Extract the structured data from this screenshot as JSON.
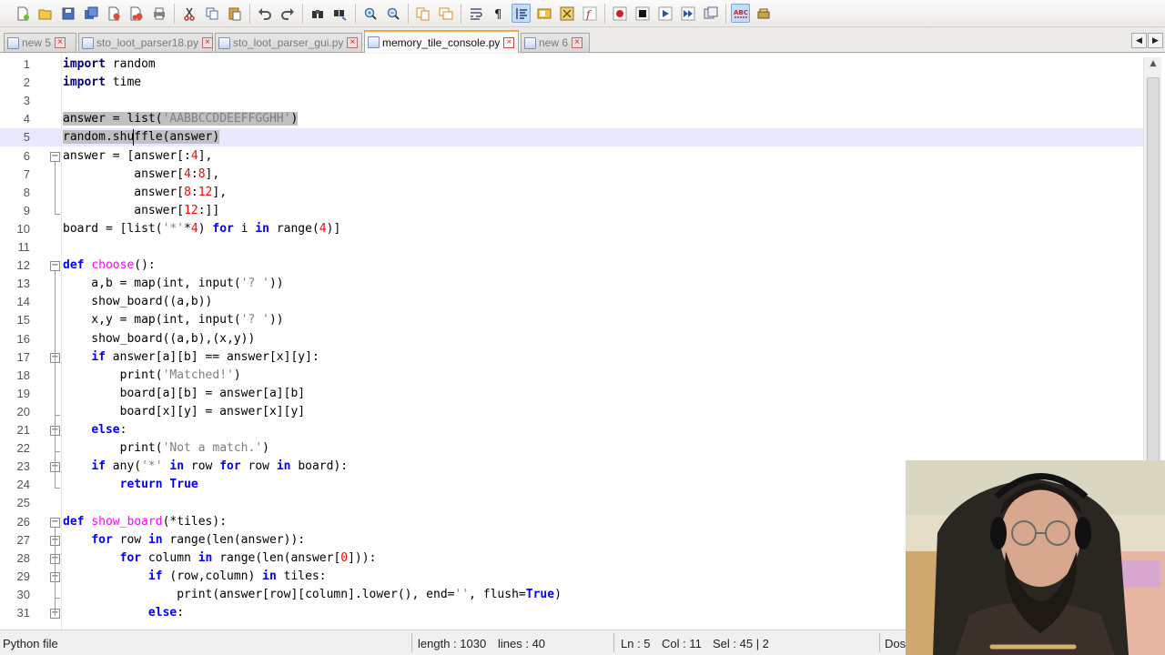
{
  "toolbar": {
    "icons": [
      "new-file",
      "open-file",
      "save",
      "save-all",
      "close",
      "close-all",
      "print",
      "cut",
      "copy",
      "paste",
      "undo",
      "redo",
      "find",
      "replace",
      "zoom-in",
      "zoom-out",
      "sync-vertical",
      "sync-horizontal",
      "word-wrap",
      "show-all-chars",
      "indent-guide",
      "user-define",
      "doc-map",
      "function-list",
      "record-macro",
      "stop-record",
      "play-macro",
      "run-macro-multiple",
      "save-macro",
      "spell-check",
      "trash"
    ]
  },
  "tabs": [
    {
      "label": "new  5",
      "active": false
    },
    {
      "label": "sto_loot_parser18.py",
      "active": false
    },
    {
      "label": "sto_loot_parser_gui.py",
      "active": false
    },
    {
      "label": "memory_tile_console.py",
      "active": true
    },
    {
      "label": "new  6",
      "active": false
    }
  ],
  "editor": {
    "language": "Python",
    "current_line": 5,
    "lines": [
      "import random",
      "import time",
      "",
      "answer = list('AABBCCDDEEFFGGHH')",
      "random.shuffle(answer)",
      "answer = [answer[:4],",
      "          answer[4:8],",
      "          answer[8:12],",
      "          answer[12:]]",
      "board = [list('*'*4) for i in range(4)]",
      "",
      "def choose():",
      "    a,b = map(int, input('? '))",
      "    show_board((a,b))",
      "    x,y = map(int, input('? '))",
      "    show_board((a,b),(x,y))",
      "    if answer[a][b] == answer[x][y]:",
      "        print('Matched!')",
      "        board[a][b] = answer[a][b]",
      "        board[x][y] = answer[x][y]",
      "    else:",
      "        print('Not a match.')",
      "    if any('*' in row for row in board):",
      "        return True",
      "",
      "def show_board(*tiles):",
      "    for row in range(len(answer)):",
      "        for column in range(len(answer[0])):",
      "            if (row,column) in tiles:",
      "                print(answer[row][column].lower(), end='', flush=True)",
      "            else:"
    ]
  },
  "status": {
    "file_type": "Python file",
    "length": "length : 1030",
    "lines": "lines : 40",
    "ln": "Ln : 5",
    "col": "Col : 11",
    "sel": "Sel : 45 | 2",
    "eol": "Dos"
  },
  "colors": {
    "keyword": "#0000ff",
    "import_keyword": "#000080",
    "function_name": "#ff00ff",
    "string": "#808080",
    "number": "#ff0000",
    "current_line": "#e8e8ff",
    "selection": "#c0c0c0",
    "active_tab_accent": "#f5a442"
  }
}
